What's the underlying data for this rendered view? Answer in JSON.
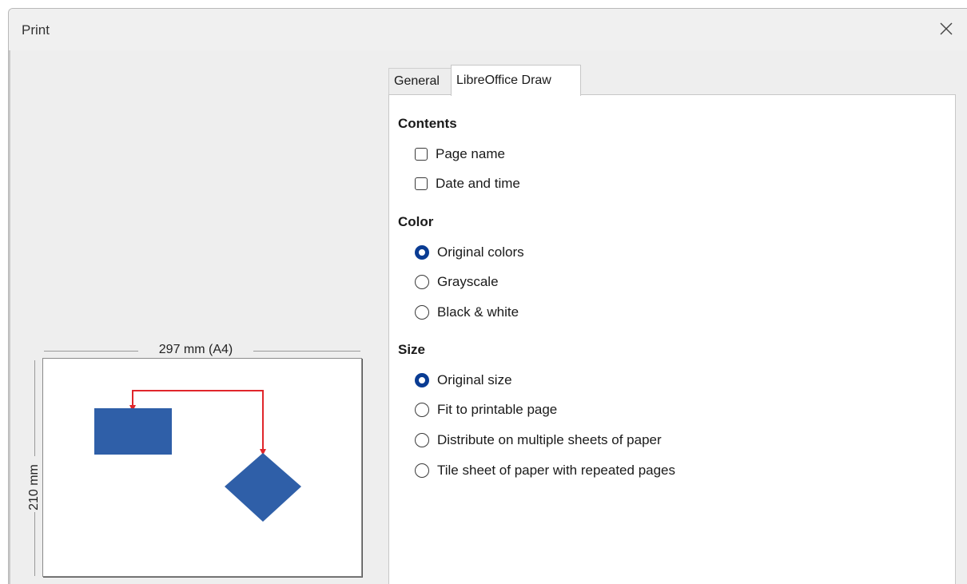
{
  "window": {
    "title": "Print"
  },
  "preview": {
    "width_label": "297 mm (A4)",
    "height_label": "210 mm"
  },
  "tabs": [
    {
      "label": "General",
      "selected": false
    },
    {
      "label": "LibreOffice Draw",
      "selected": true
    }
  ],
  "contents": {
    "heading": "Contents",
    "options": [
      {
        "label": "Page name",
        "checked": false
      },
      {
        "label": "Date and time",
        "checked": false
      }
    ]
  },
  "color": {
    "heading": "Color",
    "options": [
      {
        "label": "Original colors",
        "selected": true
      },
      {
        "label": "Grayscale",
        "selected": false
      },
      {
        "label": "Black & white",
        "selected": false
      }
    ]
  },
  "size": {
    "heading": "Size",
    "options": [
      {
        "label": "Original size",
        "selected": true
      },
      {
        "label": "Fit to printable page",
        "selected": false
      },
      {
        "label": "Distribute on multiple sheets of paper",
        "selected": false
      },
      {
        "label": "Tile sheet of paper with repeated pages",
        "selected": false
      }
    ]
  },
  "colors": {
    "shape_fill": "#2f5fa8",
    "connector": "#e0262b",
    "radio_selected": "#0a3c93"
  },
  "icons": {
    "close": "close-icon"
  }
}
